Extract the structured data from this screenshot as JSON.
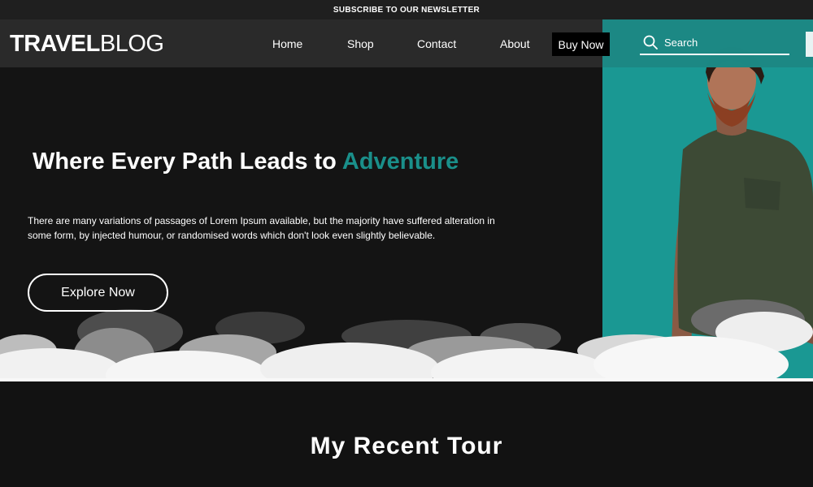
{
  "topbar": {
    "label": "SUBSCRIBE TO OUR NEWSLETTER"
  },
  "brand": {
    "bold": "TRAVEL",
    "light": "BLOG"
  },
  "nav": {
    "items": [
      {
        "label": "Home"
      },
      {
        "label": "Shop"
      },
      {
        "label": "Contact"
      },
      {
        "label": "About"
      }
    ],
    "cta": "Buy Now"
  },
  "search": {
    "placeholder": "Search",
    "icon": "search-icon"
  },
  "hero": {
    "headline_main": "Where Every Path Leads to ",
    "headline_accent": "Adventure",
    "description": "There are many variations of passages of Lorem Ipsum available, but the majority have suffered alteration in some form, by injected humour, or randomised words which don't look even slightly believable.",
    "button": "Explore Now"
  },
  "recent": {
    "title": "My Recent Tour"
  },
  "colors": {
    "accent": "#1a9893",
    "background": "#141414",
    "navbar": "#2b2b2b"
  }
}
